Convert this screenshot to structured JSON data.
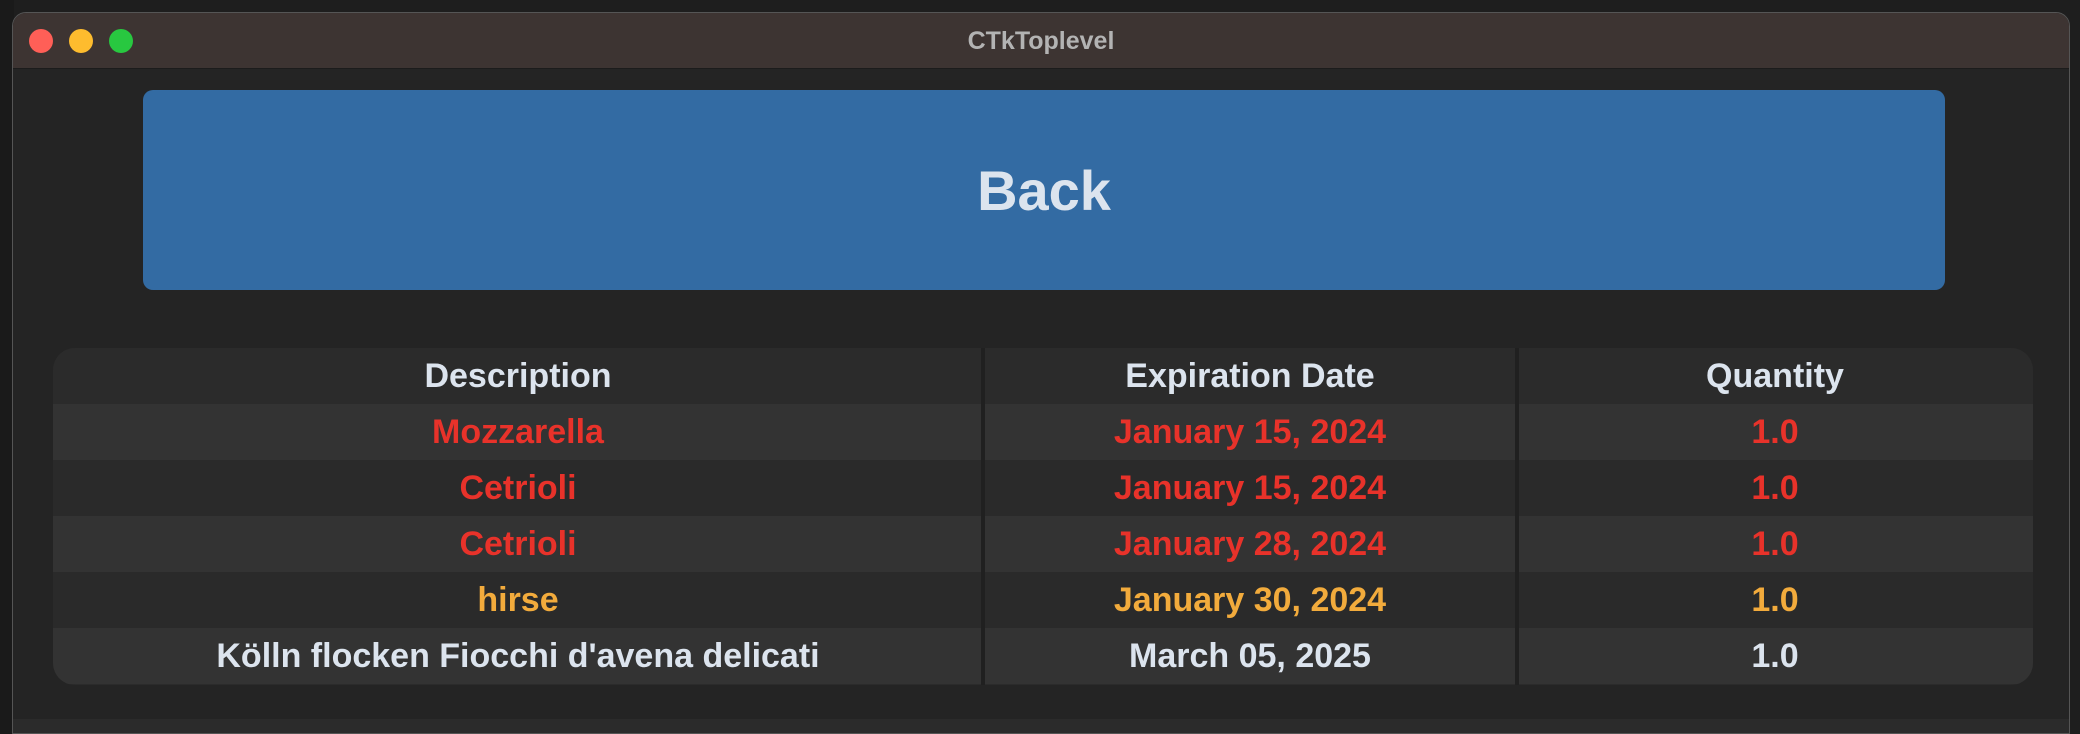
{
  "window": {
    "title": "CTkToplevel"
  },
  "back_button": {
    "label": "Back"
  },
  "table": {
    "columns": [
      "Description",
      "Expiration Date",
      "Quantity"
    ],
    "rows": [
      {
        "description": "Mozzarella",
        "expiration": "January 15, 2024",
        "quantity": "1.0",
        "status": "expired"
      },
      {
        "description": "Cetrioli",
        "expiration": "January 15, 2024",
        "quantity": "1.0",
        "status": "expired"
      },
      {
        "description": "Cetrioli",
        "expiration": "January 28, 2024",
        "quantity": "1.0",
        "status": "expired"
      },
      {
        "description": "hirse",
        "expiration": "January 30, 2024",
        "quantity": "1.0",
        "status": "expiring"
      },
      {
        "description": "Kölln flocken Fiocchi d'avena delicati",
        "expiration": "March 05, 2025",
        "quantity": "1.0",
        "status": "ok"
      }
    ]
  },
  "colors": {
    "expired": "#e8322a",
    "expiring": "#f2ab3c",
    "ok": "#dce4ee",
    "header_text": "#dce4ee",
    "button_bg": "#336ba3"
  }
}
